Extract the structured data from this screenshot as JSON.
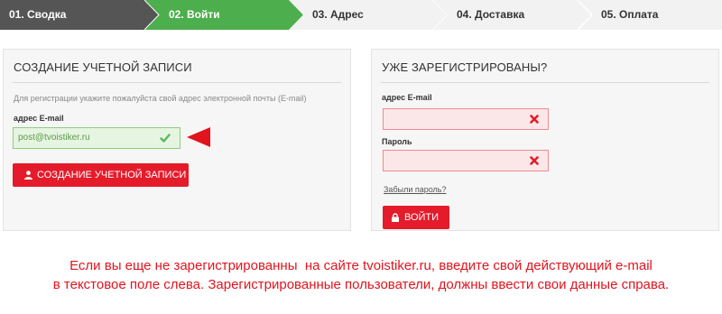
{
  "steps": [
    {
      "label": "01. Сводка",
      "state": "done"
    },
    {
      "label": "02. Войти",
      "state": "active"
    },
    {
      "label": "03. Адрес",
      "state": "todo"
    },
    {
      "label": "04. Доставка",
      "state": "todo"
    },
    {
      "label": "05. Оплата",
      "state": "todo"
    }
  ],
  "create_account": {
    "title": "СОЗДАНИЕ УЧЕТНОЙ ЗАПИСИ",
    "hint": "Для регистрации укажите пожалуйста свой адрес электронной почты (E-mail)",
    "email_label": "адрес E-mail",
    "email_value": "post@tvoistiker.ru",
    "email_state": "valid",
    "button_label": "СОЗДАНИЕ УЧЕТНОЙ ЗАПИСИ",
    "button_icon": "user-icon"
  },
  "login": {
    "title": "УЖЕ ЗАРЕГИСТРИРОВАНЫ?",
    "email_label": "адрес E-mail",
    "email_value": "",
    "password_label": "Пароль",
    "password_value": "",
    "field_state": "error",
    "forgot_link": "Забыли пароль?",
    "button_label": "ВОЙТИ",
    "button_icon": "lock-icon"
  },
  "note": {
    "line1": "Если вы еще не зарегистрированны  на сайте tvoistiker.ru, введите свой действующий e-mail",
    "line2": "в текстовое поле слева. Зарегистрированные пользователи, должны ввести свои данные справа."
  },
  "colors": {
    "step_done": "#555555",
    "step_active": "#4cae4c",
    "step_todo": "#f2f2f2",
    "accent_red": "#e41b2a",
    "valid_green": "#8ccf7a",
    "error_red": "#f08a94"
  }
}
